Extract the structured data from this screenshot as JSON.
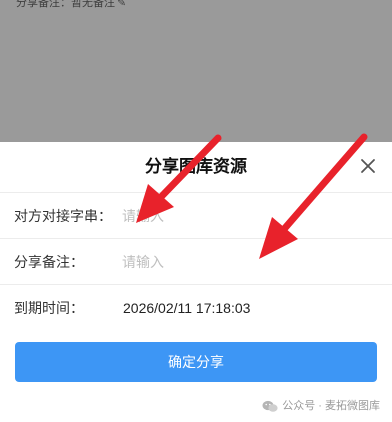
{
  "background": {
    "remark_text": "分享备注：暂无备注",
    "edit_icon": "pencil-icon"
  },
  "sheet": {
    "title": "分享图库资源",
    "close_icon": "close-icon",
    "rows": [
      {
        "label": "对方对接字串：",
        "placeholder": "请输入",
        "value": ""
      },
      {
        "label": "分享备注：",
        "placeholder": "请输入",
        "value": ""
      },
      {
        "label": "到期时间：",
        "value": "2026/02/11 17:18:03"
      }
    ],
    "confirm_label": "确定分享"
  },
  "watermark": {
    "text": "公众号 · 麦拓微图库",
    "icon": "wechat-icon"
  },
  "annotations": {
    "arrow_color": "#e8222b"
  },
  "colors": {
    "accent": "#3d96f5",
    "backdrop": "#9a9a9a"
  }
}
